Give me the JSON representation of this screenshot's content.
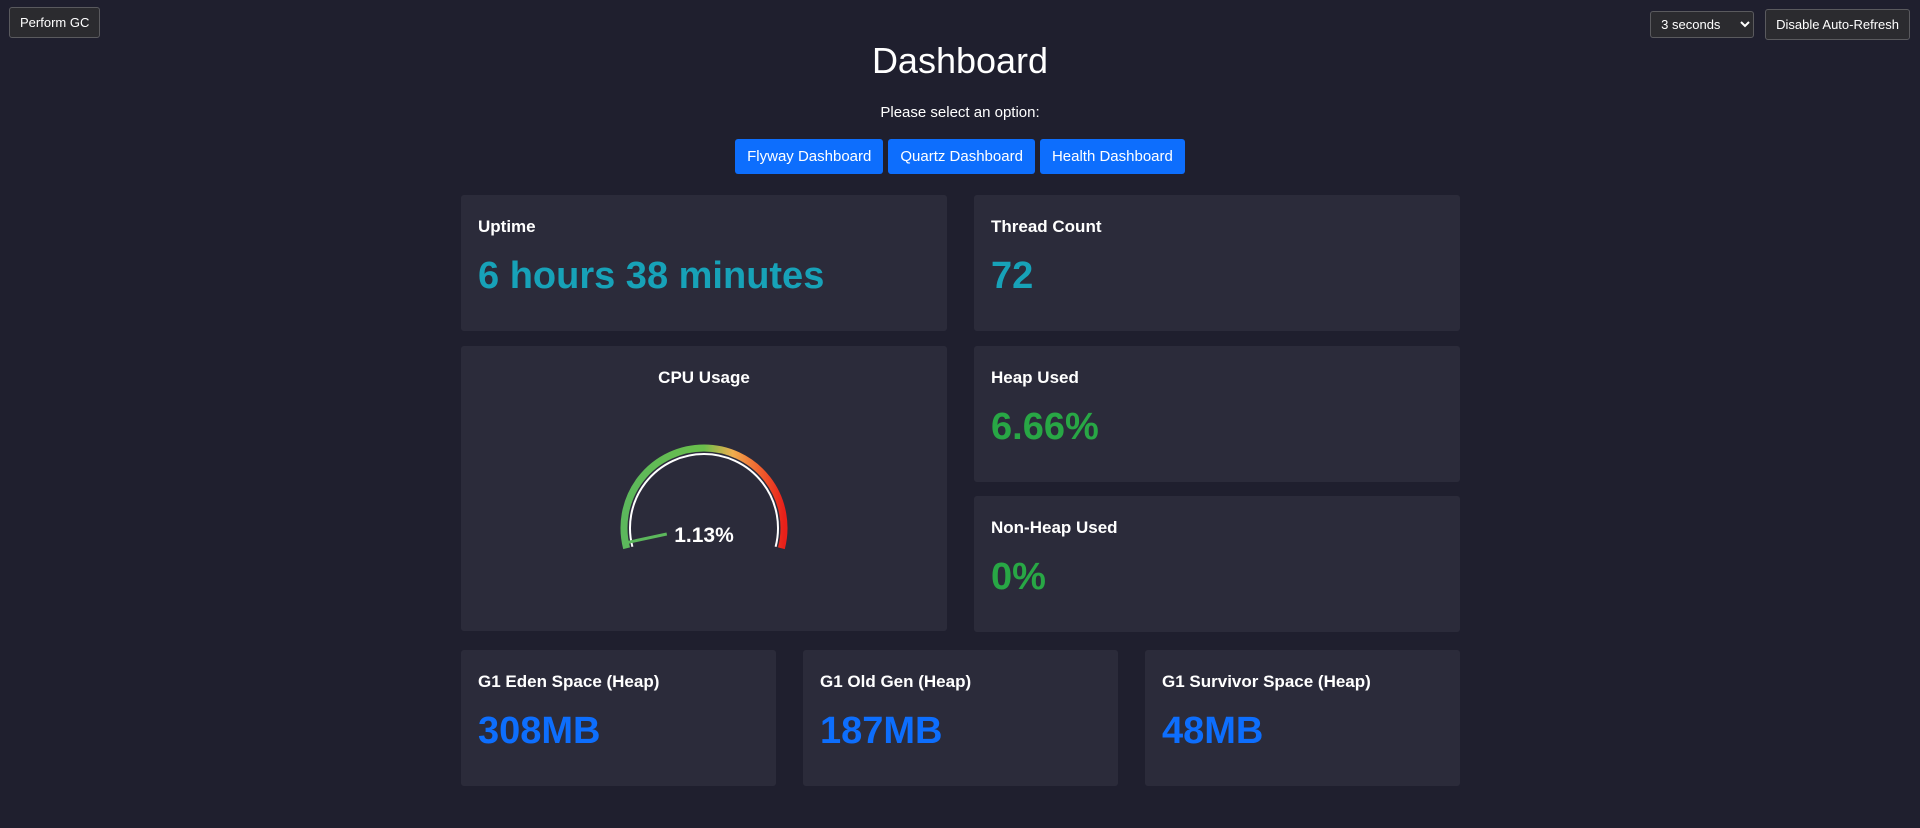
{
  "topbar": {
    "gc_label": "Perform GC",
    "refresh_interval": "3 seconds",
    "refresh_options": [
      "3 seconds"
    ],
    "disable_refresh_label": "Disable Auto-Refresh"
  },
  "header": {
    "title": "Dashboard",
    "prompt": "Please select an option:"
  },
  "nav": {
    "flyway": "Flyway Dashboard",
    "quartz": "Quartz Dashboard",
    "health": "Health Dashboard"
  },
  "cards": {
    "uptime": {
      "title": "Uptime",
      "value": "6 hours 38 minutes"
    },
    "threads": {
      "title": "Thread Count",
      "value": "72"
    },
    "cpu": {
      "title": "CPU Usage",
      "value_label": "1.13%",
      "value": 1.13,
      "max": 100
    },
    "heap": {
      "title": "Heap Used",
      "value": "6.66%"
    },
    "nonheap": {
      "title": "Non-Heap Used",
      "value": "0%"
    },
    "eden": {
      "title": "G1 Eden Space (Heap)",
      "value": "308MB"
    },
    "oldgen": {
      "title": "G1 Old Gen (Heap)",
      "value": "187MB"
    },
    "survivor": {
      "title": "G1 Survivor Space (Heap)",
      "value": "48MB"
    }
  },
  "colors": {
    "background": "#1f1f2e",
    "card": "#2b2b3a",
    "accent_blue": "#0d6efd",
    "teal": "#17a2b8",
    "green": "#28a745"
  }
}
